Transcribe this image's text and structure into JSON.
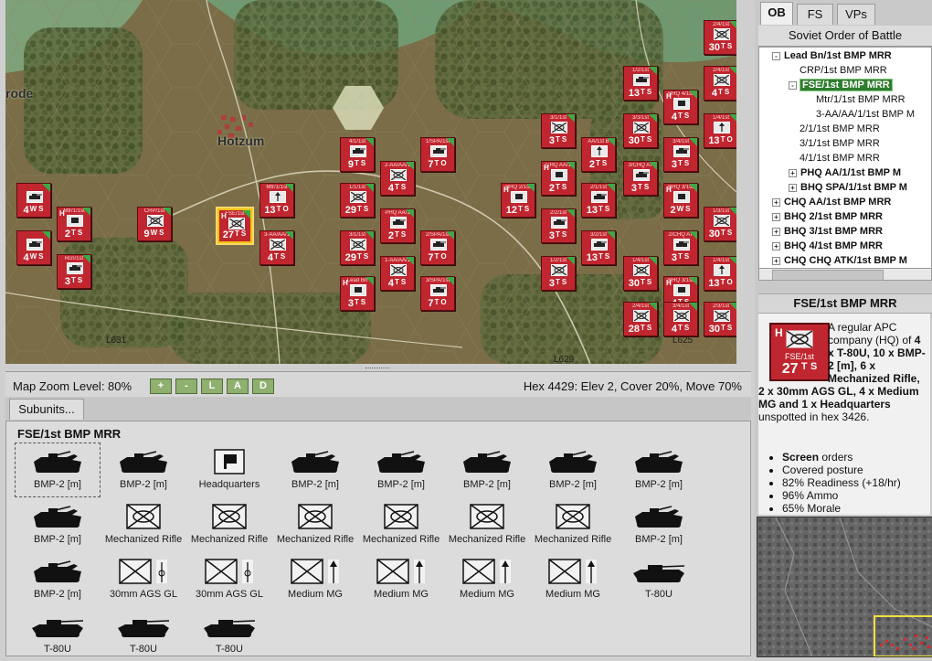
{
  "map": {
    "places": {
      "rode": "rode",
      "hotzum": "Hotzum"
    },
    "hex_labels": {
      "l631": "L631",
      "l625": "L625",
      "l629": "L629",
      "l2": "2"
    }
  },
  "counters": [
    {
      "top": "",
      "stats": [
        "4",
        "W",
        "S"
      ],
      "kind": "tank"
    },
    {
      "top": "",
      "stats": [
        "4",
        "W",
        "S"
      ],
      "kind": "tank"
    },
    {
      "top": "Rcn/1st",
      "stats": [
        "3",
        "T",
        "S"
      ],
      "kind": "tank"
    },
    {
      "top": "Mtr/1/1st",
      "stats": [
        "2",
        "T",
        "S"
      ],
      "kind": "hq",
      "hq": "H"
    },
    {
      "top": "CRP/1st",
      "stats": [
        "9",
        "W",
        "S"
      ],
      "kind": "inf"
    },
    {
      "top": "FSE/1st",
      "stats": [
        "27",
        "T",
        "S"
      ],
      "kind": "inf",
      "hq": "H",
      "selected": true
    },
    {
      "top": "Mtr/1/1st",
      "stats": [
        "13",
        "T",
        "O"
      ],
      "kind": "arrow"
    },
    {
      "top": "3-AA/AA/1",
      "stats": [
        "4",
        "T",
        "S"
      ],
      "kind": "inf"
    },
    {
      "top": "4/1/1st",
      "stats": [
        "9",
        "T",
        "S"
      ],
      "kind": "tank"
    },
    {
      "top": "1/1/1st",
      "stats": [
        "29",
        "T",
        "S"
      ],
      "kind": "inf"
    },
    {
      "top": "3/1/1st",
      "stats": [
        "29",
        "T",
        "S"
      ],
      "kind": "inf"
    },
    {
      "top": "Lead Bn",
      "stats": [
        "3",
        "T",
        "S"
      ],
      "kind": "hq",
      "hq": "H"
    },
    {
      "top": "2-AA/AA/1",
      "stats": [
        "4",
        "T",
        "S"
      ],
      "kind": "inf"
    },
    {
      "top": "PHQ AA/1",
      "stats": [
        "2",
        "T",
        "S"
      ],
      "kind": "tank"
    },
    {
      "top": "1-AA/AA/1",
      "stats": [
        "4",
        "T",
        "S"
      ],
      "kind": "inf"
    },
    {
      "top": "1/SPA/1st",
      "stats": [
        "7",
        "T",
        "O"
      ],
      "kind": "tank"
    },
    {
      "top": "2/SPA/1st",
      "stats": [
        "7",
        "T",
        "O"
      ],
      "kind": "tank"
    },
    {
      "top": "3/SPA/1st",
      "stats": [
        "7",
        "T",
        "O"
      ],
      "kind": "tank"
    },
    {
      "top": "BHQ 2/1st",
      "stats": [
        "12",
        "T",
        "S"
      ],
      "kind": "hq",
      "hq": "H"
    },
    {
      "top": "3/1/1st",
      "stats": [
        "3",
        "T",
        "S"
      ],
      "kind": "inf"
    },
    {
      "top": "CHQ AA/1",
      "stats": [
        "2",
        "T",
        "S"
      ],
      "kind": "hq",
      "hq": "H"
    },
    {
      "top": "2/2/1st",
      "stats": [
        "3",
        "T",
        "S"
      ],
      "kind": "tank"
    },
    {
      "top": "1/2/1st",
      "stats": [
        "3",
        "T",
        "S"
      ],
      "kind": "inf"
    },
    {
      "top": "AA/1st B",
      "stats": [
        "2",
        "T",
        "S"
      ],
      "kind": "arrow"
    },
    {
      "top": "2/1/1st",
      "stats": [
        "13",
        "T",
        "S"
      ],
      "kind": "tank"
    },
    {
      "top": "3/2/1st",
      "stats": [
        "13",
        "T",
        "S"
      ],
      "kind": "tank"
    },
    {
      "top": "1/2/1st",
      "stats": [
        "13",
        "T",
        "S"
      ],
      "kind": "tank"
    },
    {
      "top": "3/3/1st",
      "stats": [
        "30",
        "T",
        "S"
      ],
      "kind": "inf"
    },
    {
      "top": "2/3/1st",
      "stats": [
        "30",
        "T",
        "S"
      ],
      "kind": "inf"
    },
    {
      "top": "1/4/1st",
      "stats": [
        "30",
        "T",
        "S"
      ],
      "kind": "inf"
    },
    {
      "top": "3/CHQ AT",
      "stats": [
        "3",
        "T",
        "S"
      ],
      "kind": "tank"
    },
    {
      "top": "BHQ 4/1st",
      "stats": [
        "4",
        "T",
        "S"
      ],
      "kind": "hq",
      "hq": "H"
    },
    {
      "top": "3/4/1st",
      "stats": [
        "3",
        "T",
        "S"
      ],
      "kind": "tank"
    },
    {
      "top": "BHQ 3/1st",
      "stats": [
        "2",
        "W",
        "S"
      ],
      "kind": "hq",
      "hq": "H"
    },
    {
      "top": "2/CHQ AT",
      "stats": [
        "3",
        "T",
        "S"
      ],
      "kind": "tank"
    },
    {
      "top": "BHQ 3/1st",
      "stats": [
        "4",
        "T",
        "S"
      ],
      "kind": "hq",
      "hq": "H"
    },
    {
      "top": "3/3/1st",
      "stats": [
        "30",
        "T",
        "S"
      ],
      "kind": "inf"
    },
    {
      "top": "3/4/1st",
      "stats": [
        "4",
        "T",
        "S"
      ],
      "kind": "inf"
    },
    {
      "top": "2/4/1st",
      "stats": [
        "30",
        "T",
        "S"
      ],
      "kind": "inf"
    },
    {
      "top": "2/4/1st",
      "stats": [
        "4",
        "T",
        "S"
      ],
      "kind": "inf"
    },
    {
      "top": "1/4/1st",
      "stats": [
        "13",
        "T",
        "O"
      ],
      "kind": "arrow"
    },
    {
      "top": "1/3/1st",
      "stats": [
        "30",
        "T",
        "S"
      ],
      "kind": "inf"
    },
    {
      "top": "1/4/1st",
      "stats": [
        "13",
        "T",
        "O"
      ],
      "kind": "arrow"
    },
    {
      "top": "2/3/1st",
      "stats": [
        "30",
        "T",
        "S"
      ],
      "kind": "inf"
    },
    {
      "top": "2/4/1st",
      "stats": [
        "28",
        "T",
        "S"
      ],
      "kind": "inf"
    }
  ],
  "statusbar": {
    "zoom_label": "Map Zoom Level: 80%",
    "buttons": [
      "+",
      "-",
      "L",
      "A",
      "D"
    ],
    "hex_info": "Hex 4429: Elev 2, Cover 20%, Move 70%"
  },
  "subunits": {
    "tab_label": "Subunits...",
    "title": "FSE/1st BMP MRR",
    "items": [
      {
        "label": "BMP-2 [m]",
        "icon": "apc-icon"
      },
      {
        "label": "BMP-2 [m]",
        "icon": "apc-icon"
      },
      {
        "label": "Headquarters",
        "icon": "flag-icon"
      },
      {
        "label": "BMP-2 [m]",
        "icon": "apc-icon"
      },
      {
        "label": "BMP-2 [m]",
        "icon": "apc-icon"
      },
      {
        "label": "BMP-2 [m]",
        "icon": "apc-icon"
      },
      {
        "label": "BMP-2 [m]",
        "icon": "apc-icon"
      },
      {
        "label": "BMP-2 [m]",
        "icon": "apc-icon"
      },
      {
        "label": "BMP-2 [m]",
        "icon": "apc-icon"
      },
      {
        "label": "Mechanized Rifle",
        "icon": "infantry-icon"
      },
      {
        "label": "Mechanized Rifle",
        "icon": "infantry-icon"
      },
      {
        "label": "Mechanized Rifle",
        "icon": "infantry-icon"
      },
      {
        "label": "Mechanized Rifle",
        "icon": "infantry-icon"
      },
      {
        "label": "Mechanized Rifle",
        "icon": "infantry-icon"
      },
      {
        "label": "Mechanized Rifle",
        "icon": "infantry-icon"
      },
      {
        "label": "BMP-2 [m]",
        "icon": "apc-icon"
      },
      {
        "label": "BMP-2 [m]",
        "icon": "apc-icon"
      },
      {
        "label": "30mm AGS GL",
        "icon": "grenade-launcher-icon"
      },
      {
        "label": "30mm AGS GL",
        "icon": "grenade-launcher-icon"
      },
      {
        "label": "Medium MG",
        "icon": "machine-gun-icon"
      },
      {
        "label": "Medium MG",
        "icon": "machine-gun-icon"
      },
      {
        "label": "Medium MG",
        "icon": "machine-gun-icon"
      },
      {
        "label": "Medium MG",
        "icon": "machine-gun-icon"
      },
      {
        "label": "T-80U",
        "icon": "tank-icon"
      },
      {
        "label": "T-80U",
        "icon": "tank-icon"
      },
      {
        "label": "T-80U",
        "icon": "tank-icon"
      },
      {
        "label": "T-80U",
        "icon": "tank-icon"
      }
    ]
  },
  "right_panel": {
    "tabs": [
      "OB",
      "FS",
      "VPs"
    ],
    "ob_title": "Soviet Order of Battle",
    "tree": [
      {
        "label": "Lead Bn/1st BMP MRR",
        "bold": true,
        "pm": "-",
        "indent": 0
      },
      {
        "label": "CRP/1st BMP MRR",
        "bold": false,
        "pm": "",
        "indent": 1
      },
      {
        "label": "FSE/1st BMP MRR",
        "bold": true,
        "pm": "-",
        "indent": 1,
        "selected": true
      },
      {
        "label": "Mtr/1/1st BMP MRR",
        "bold": false,
        "pm": "",
        "indent": 2
      },
      {
        "label": "3-AA/AA/1/1st BMP M",
        "bold": false,
        "pm": "",
        "indent": 2
      },
      {
        "label": "2/1/1st BMP MRR",
        "bold": false,
        "pm": "",
        "indent": 1
      },
      {
        "label": "3/1/1st BMP MRR",
        "bold": false,
        "pm": "",
        "indent": 1
      },
      {
        "label": "4/1/1st BMP MRR",
        "bold": false,
        "pm": "",
        "indent": 1
      },
      {
        "label": "PHQ AA/1/1st BMP M",
        "bold": true,
        "pm": "+",
        "indent": 1
      },
      {
        "label": "BHQ SPA/1/1st BMP M",
        "bold": true,
        "pm": "+",
        "indent": 1
      },
      {
        "label": "CHQ AA/1st BMP MRR",
        "bold": true,
        "pm": "+",
        "indent": 0
      },
      {
        "label": "BHQ 2/1st BMP MRR",
        "bold": true,
        "pm": "+",
        "indent": 0
      },
      {
        "label": "BHQ 3/1st BMP MRR",
        "bold": true,
        "pm": "+",
        "indent": 0
      },
      {
        "label": "BHQ 4/1st BMP MRR",
        "bold": true,
        "pm": "+",
        "indent": 0
      },
      {
        "label": "CHQ CHQ ATK/1st BMP M",
        "bold": true,
        "pm": "+",
        "indent": 0
      }
    ],
    "unit_title": "FSE/1st BMP MRR",
    "big_counter": {
      "hq": "H",
      "name": "FSE/1st",
      "strength": "27",
      "t": "T",
      "s": "S"
    },
    "description": {
      "p1": "A regular APC company (HQ) of ",
      "b1": "4 x T-80U, 10 x BMP-2 [m], 6 x Mechanized Rifle, 2 x 30mm AGS GL, 4 x Medium MG and 1 x Headquarters",
      "p2": " unspotted in hex 3426."
    },
    "status_list": [
      {
        "bold": "Screen",
        "rest": " orders"
      },
      {
        "bold": "",
        "rest": "Covered posture"
      },
      {
        "bold": "",
        "rest": "82% Readiness (+18/hr)"
      },
      {
        "bold": "",
        "rest": "96% Ammo"
      },
      {
        "bold": "",
        "rest": "65% Morale"
      }
    ]
  }
}
